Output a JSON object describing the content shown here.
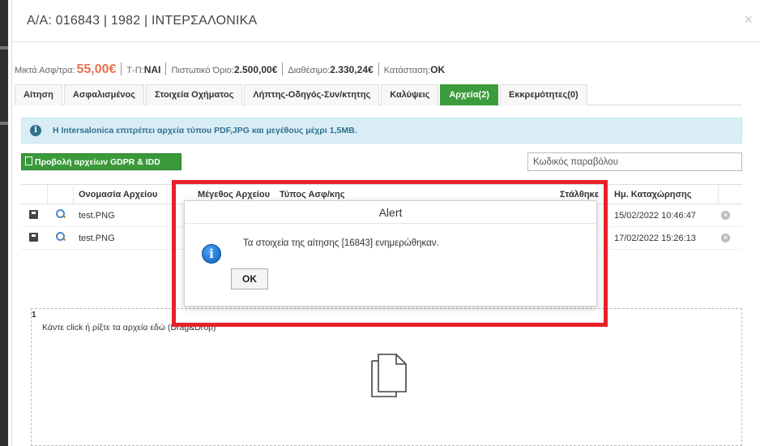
{
  "header": {
    "title": "Α/Α: 016843 | 1982 | ΙΝΤΕΡΣΑΛΟΝΙΚΑ",
    "close": "×"
  },
  "summary": {
    "premium_label": "Μικτά Ασφ/τρα:",
    "premium_value": "55,00€",
    "tp_label": "Τ-Π:",
    "tp_value": "ΝΑΙ",
    "credit_label": "Πιστωτικό Όριο:",
    "credit_value": "2.500,00€",
    "available_label": "Διαθέσιμο:",
    "available_value": "2.330,24€",
    "status_label": "Κατάσταση:",
    "status_value": "OK"
  },
  "tabs": [
    {
      "label": "Αίτηση"
    },
    {
      "label": "Ασφαλισμένος"
    },
    {
      "label": "Στοιχεία Οχήματος"
    },
    {
      "label": "Λήπτης-Οδηγός-Συν/κτητης"
    },
    {
      "label": "Καλύψεις"
    },
    {
      "label": "Αρχεία(2)",
      "active": true
    },
    {
      "label": "Εκκρεμότητες(0)"
    }
  ],
  "info": {
    "icon": "info-icon",
    "text": "Η Intersalonica επιτρέπει αρχεία τύπου PDF,JPG και μεγέθους μέχρι 1,5MB."
  },
  "gdpr_button": "Προβολή αρχείων GDPR & IDD",
  "param_input": {
    "placeholder": "Κωδικός παραβόλου"
  },
  "table": {
    "headers": {
      "name": "Ονομασία Αρχείου",
      "size": "Μέγεθος Αρχείου",
      "type": "Τύπος Ασφ/κης",
      "sent": "Στάλθηκε",
      "date": "Ημ. Καταχώρησης"
    },
    "rows": [
      {
        "name": "test.PNG",
        "date": "15/02/2022 10:46:47"
      },
      {
        "name": "test.PNG",
        "date": "17/02/2022 15:26:13"
      }
    ]
  },
  "dropzone": {
    "number": "1",
    "text": "Κάντε click ή ρίξτε τα αρχεία εδώ (Drag&Drop)"
  },
  "alert": {
    "title": "Alert",
    "message": "Τα στοιχεία της αίτησης [16843] ενημερώθηκαν.",
    "ok_label": "OK"
  },
  "colors": {
    "accent_green": "#3c9b3c",
    "highlight_red": "#e8202a",
    "premium_orange": "#e8744f",
    "info_blue": "#31708f"
  }
}
